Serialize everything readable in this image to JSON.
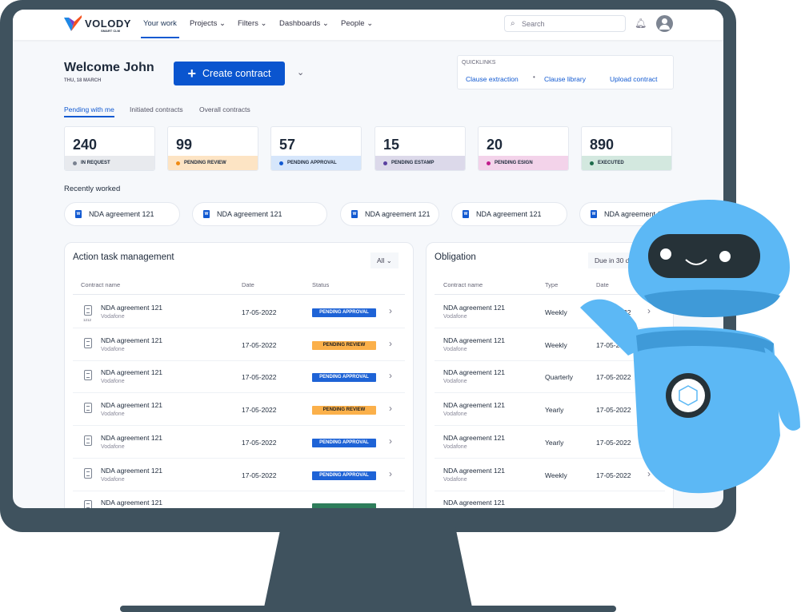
{
  "brand": {
    "name": "VOLODY",
    "tagline": "SMART CLM"
  },
  "nav": {
    "items": [
      {
        "label": "Your work",
        "active": true
      },
      {
        "label": "Projects ⌄"
      },
      {
        "label": "Filters ⌄"
      },
      {
        "label": "Dashboards ⌄"
      },
      {
        "label": "People ⌄"
      }
    ],
    "search_placeholder": "Search",
    "icons": [
      "search-icon",
      "bell-icon",
      "avatar-icon"
    ]
  },
  "header": {
    "welcome": "Welcome John",
    "date": "THU, 18 MARCH",
    "create_label": "Create contract"
  },
  "quicklinks": {
    "title": "QUICKLINKS",
    "links": [
      "Clause extraction",
      "Clause library",
      "Upload contract"
    ]
  },
  "tabs": [
    "Pending with me",
    "Initiated contracts",
    "Overall contracts"
  ],
  "stats": [
    {
      "value": "240",
      "label": "IN REQUEST",
      "bg": "#e8eaee",
      "dot": "#7a8290"
    },
    {
      "value": "99",
      "label": "PENDING REVIEW",
      "bg": "#fde4c4",
      "dot": "#f08a12"
    },
    {
      "value": "57",
      "label": "PENDING APPROVAL",
      "bg": "#d6e6fb",
      "dot": "#1159d1"
    },
    {
      "value": "15",
      "label": "PENDING ESTAMP",
      "bg": "#dcd9ea",
      "dot": "#5a3fa0"
    },
    {
      "value": "20",
      "label": "PENDING ESIGN",
      "bg": "#f3d3ea",
      "dot": "#c21c8c"
    },
    {
      "value": "890",
      "label": "EXECUTED",
      "bg": "#d3e8df",
      "dot": "#1d6b4a"
    }
  ],
  "recent": {
    "title": "Recently worked",
    "items": [
      "NDA agreement 121",
      "NDA agreement 121",
      "NDA agreement 121",
      "NDA agreement 121",
      "NDA agreement 121"
    ]
  },
  "action": {
    "title": "Action task management",
    "filter": "All ⌄",
    "columns": [
      "Contract name",
      "Date",
      "Status"
    ],
    "rows": [
      {
        "name": "NDA agreement 121",
        "company": "Vodafone",
        "date": "17-05-2022",
        "status": "PENDING APPROVAL",
        "num": "1212"
      },
      {
        "name": "NDA agreement 121",
        "company": "Vodafone",
        "date": "17-05-2022",
        "status": "PENDING REVIEW"
      },
      {
        "name": "NDA agreement 121",
        "company": "Vodafone",
        "date": "17-05-2022",
        "status": "PENDING APPROVAL"
      },
      {
        "name": "NDA agreement 121",
        "company": "Vodafone",
        "date": "17-05-2022",
        "status": "PENDING REVIEW"
      },
      {
        "name": "NDA agreement 121",
        "company": "Vodafone",
        "date": "17-05-2022",
        "status": "PENDING APPROVAL"
      },
      {
        "name": "NDA agreement 121",
        "company": "Vodafone",
        "date": "17-05-2022",
        "status": "PENDING APPROVAL"
      },
      {
        "name": "NDA agreement 121",
        "company": "",
        "date": "",
        "status": ""
      }
    ]
  },
  "obligation": {
    "title": "Obligation",
    "filter": "Due in 30 days",
    "columns": [
      "Contract name",
      "Type",
      "Date"
    ],
    "rows": [
      {
        "name": "NDA agreement 121",
        "company": "Vodafone",
        "type": "Weekly",
        "date": "17-05-2022"
      },
      {
        "name": "NDA agreement 121",
        "company": "Vodafone",
        "type": "Weekly",
        "date": "17-05-2022"
      },
      {
        "name": "NDA agreement 121",
        "company": "Vodafone",
        "type": "Quarterly",
        "date": "17-05-2022"
      },
      {
        "name": "NDA agreement 121",
        "company": "Vodafone",
        "type": "Yearly",
        "date": "17-05-2022"
      },
      {
        "name": "NDA agreement 121",
        "company": "Vodafone",
        "type": "Yearly",
        "date": "17-05-2022"
      },
      {
        "name": "NDA agreement 121",
        "company": "Vodafone",
        "type": "Weekly",
        "date": "17-05-2022"
      },
      {
        "name": "NDA agreement 121",
        "company": "",
        "type": "",
        "date": ""
      }
    ]
  },
  "colors": {
    "accent": "#0a55cf",
    "approval": "#1e63d6",
    "review": "#fbb04a",
    "executed": "#2e7d5b",
    "robot": "#5cb8f5"
  }
}
